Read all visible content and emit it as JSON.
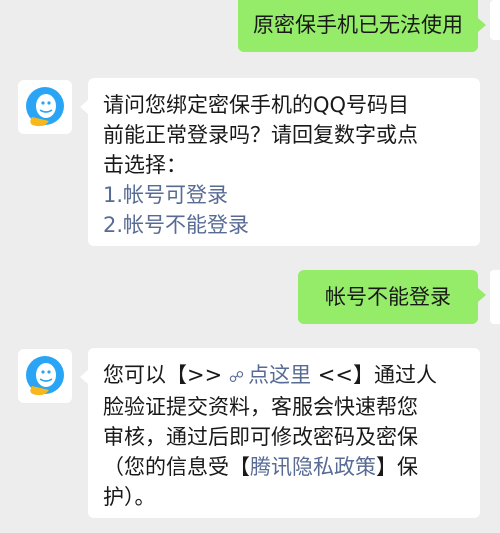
{
  "messages": [
    {
      "side": "me",
      "text": "原密保手机已无法使用"
    },
    {
      "side": "other",
      "lines": [
        "请问您绑定密保手机的QQ号码目",
        "前能正常登录吗？请回复数字或点",
        "击选择："
      ],
      "options": [
        "1.帐号可登录",
        "2.帐号不能登录"
      ]
    },
    {
      "side": "me",
      "text": "帐号不能登录"
    },
    {
      "side": "other",
      "l1_pre": "您可以【>>",
      "l1_link": "点这里",
      "l1_post": "<<】通过人",
      "l2": "脸验证提交资料，客服会快速帮您",
      "l3": "审核，通过后即可修改密码及密保",
      "l4_pre": "（您的信息受【",
      "l4_link": "腾讯隐私政策",
      "l4_post": "】保",
      "l5": "护）。"
    }
  ],
  "icons": {
    "avatar": "qq-support-avatar-icon",
    "link": "link-icon"
  },
  "colors": {
    "me_bubble": "#95ec69",
    "other_bubble": "#ffffff",
    "link": "#576b95",
    "background": "#ededed"
  }
}
